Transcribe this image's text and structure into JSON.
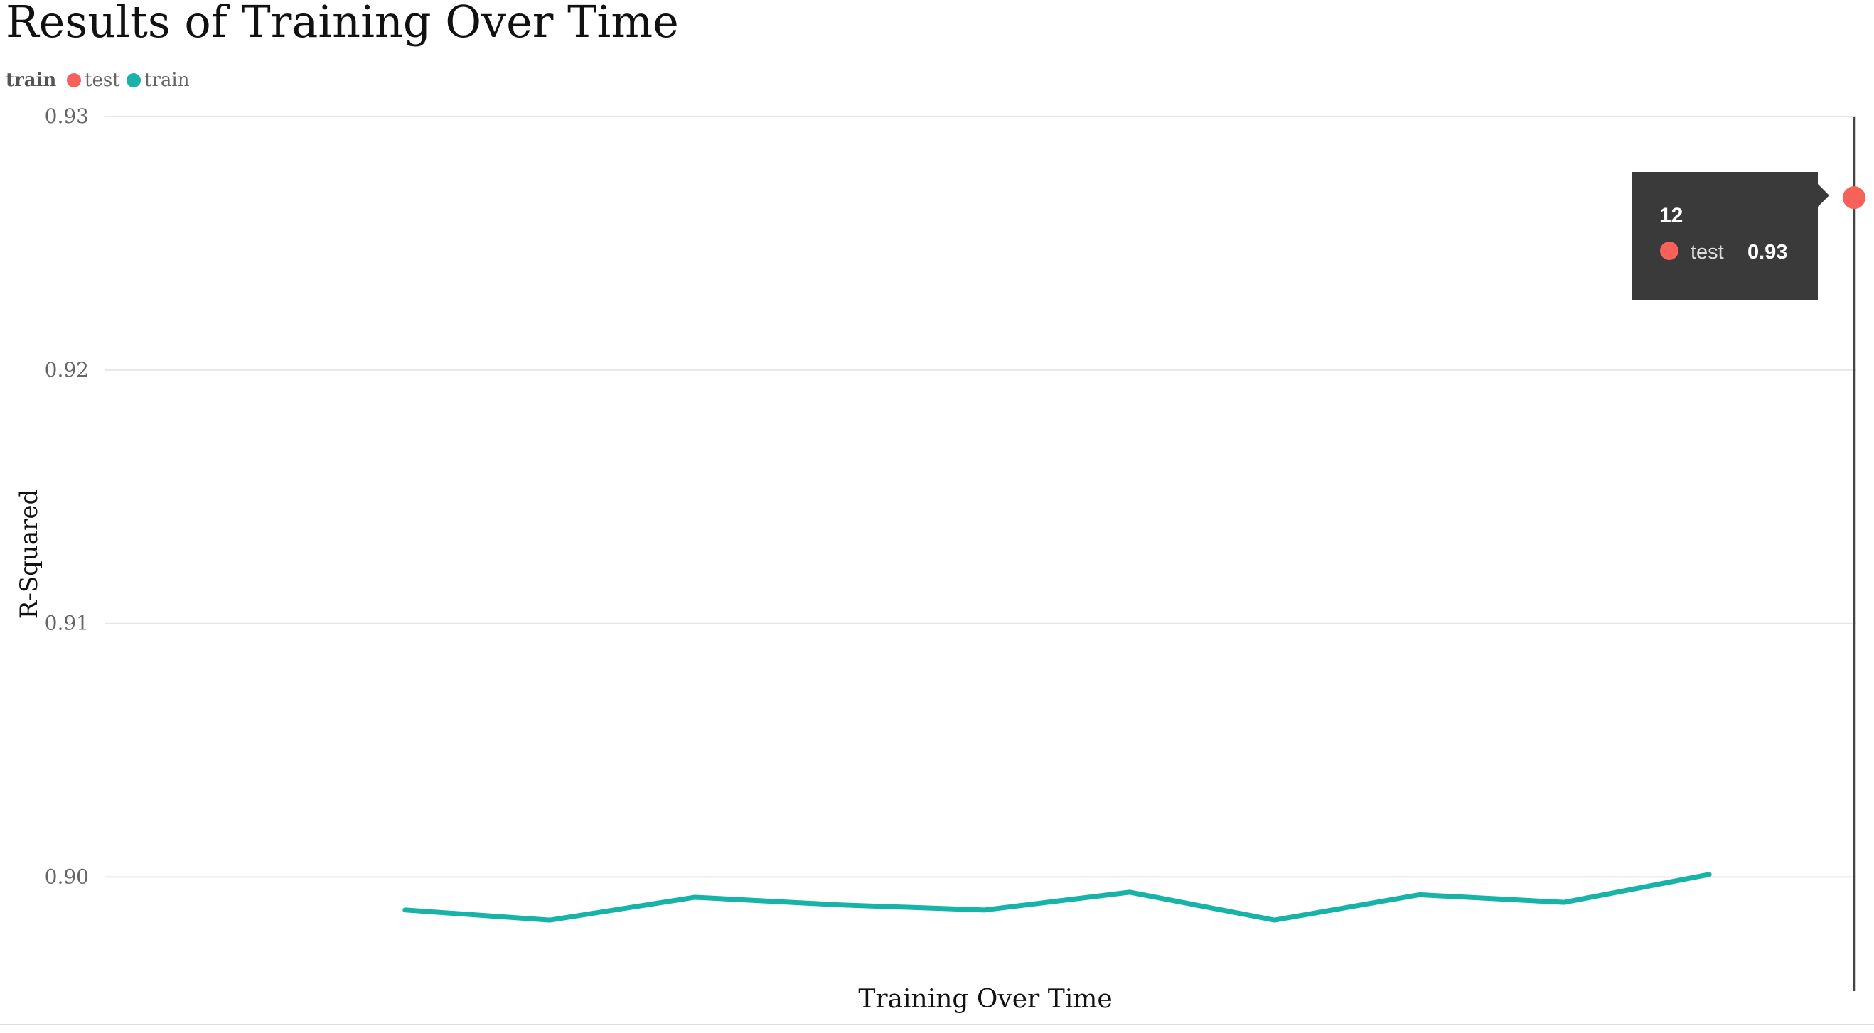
{
  "chart_data": {
    "type": "line",
    "title": "Results of Training Over Time",
    "xlabel": "Training Over Time",
    "ylabel": "R-Squared",
    "legend": {
      "title": "train",
      "position": "top-left",
      "entries": [
        {
          "name": "test",
          "color": "#f8605a"
        },
        {
          "name": "train",
          "color": "#17b3a8"
        }
      ]
    },
    "ylim": [
      0.8955,
      0.93
    ],
    "xlim": [
      1,
      12
    ],
    "yticks": [
      "0.90",
      "0.91",
      "0.92",
      "0.93"
    ],
    "grid": true,
    "series": [
      {
        "name": "train",
        "color": "#17b3a8",
        "x": [
          2,
          3,
          4,
          5,
          6,
          7,
          8,
          9,
          10,
          11
        ],
        "values": [
          0.8987,
          0.8983,
          0.8992,
          0.8989,
          0.8987,
          0.8994,
          0.8983,
          0.8993,
          0.899,
          0.9001
        ]
      },
      {
        "name": "test",
        "color": "#f8605a",
        "x": [
          12
        ],
        "values": [
          0.9268
        ]
      }
    ],
    "hover": {
      "x_value": "12",
      "series_name": "test",
      "value_label": "0.93"
    }
  }
}
